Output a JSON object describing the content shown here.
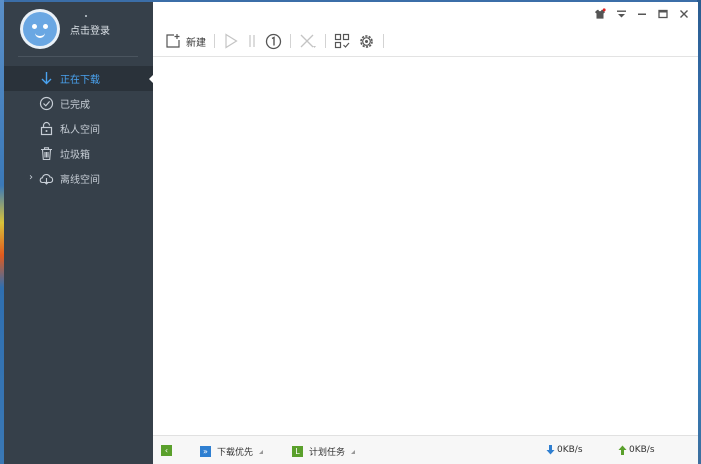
{
  "sidebar": {
    "login_text": "点击登录",
    "items": [
      {
        "label": "正在下载",
        "icon": "download-arrow-icon",
        "active": true
      },
      {
        "label": "已完成",
        "icon": "check-circle-icon"
      },
      {
        "label": "私人空间",
        "icon": "lock-icon"
      },
      {
        "label": "垃圾箱",
        "icon": "trash-icon"
      },
      {
        "label": "离线空间",
        "icon": "cloud-offline-icon"
      }
    ]
  },
  "toolbar": {
    "new_label": "新建"
  },
  "statusbar": {
    "priority_label": "下载优先",
    "schedule_label": "计划任务",
    "download_speed": "0KB/s",
    "upload_speed": "0KB/s"
  },
  "colors": {
    "sidebar_bg": "#36404a",
    "accent": "#4aa3f0",
    "green": "#5aa02c",
    "blue": "#2f7fd1",
    "notify_red": "#e02020"
  }
}
